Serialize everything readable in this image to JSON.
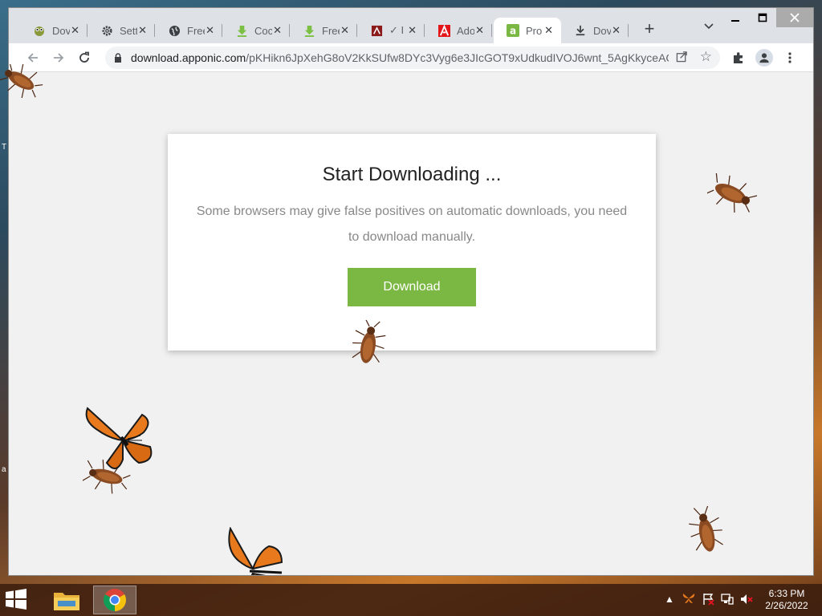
{
  "desktop": {
    "edge_chars": [
      "T",
      "a"
    ]
  },
  "browser": {
    "tabs": [
      {
        "title": "Dov",
        "icon": "owl-icon"
      },
      {
        "title": "Setti",
        "icon": "gear-icon"
      },
      {
        "title": "Free",
        "icon": "globe-icon"
      },
      {
        "title": "Coc",
        "icon": "download-arrow-icon"
      },
      {
        "title": "Free",
        "icon": "download-arrow-icon"
      },
      {
        "title": "✓ I",
        "icon": "pdf-icon"
      },
      {
        "title": "Ado",
        "icon": "adobe-icon"
      },
      {
        "title": "Pro",
        "icon": "apponic-icon",
        "active": true
      },
      {
        "title": "Dov",
        "icon": "download-icon"
      }
    ],
    "new_tab_label": "+",
    "address": {
      "host": "download.apponic.com",
      "path": "/pKHikn6JpXehG8oV2KkSUfw8DYc3Vyg6e3JIcGOT9xUdkudIVOJ6wnt_5AgKkyceACE..."
    }
  },
  "page": {
    "heading": "Start Downloading ...",
    "message": "Some browsers may give false positives on automatic downloads, you need to download manually.",
    "download_button": "Download",
    "accent_color": "#7bb843"
  },
  "taskbar": {
    "time": "6:33 PM",
    "date": "2/26/2022"
  }
}
